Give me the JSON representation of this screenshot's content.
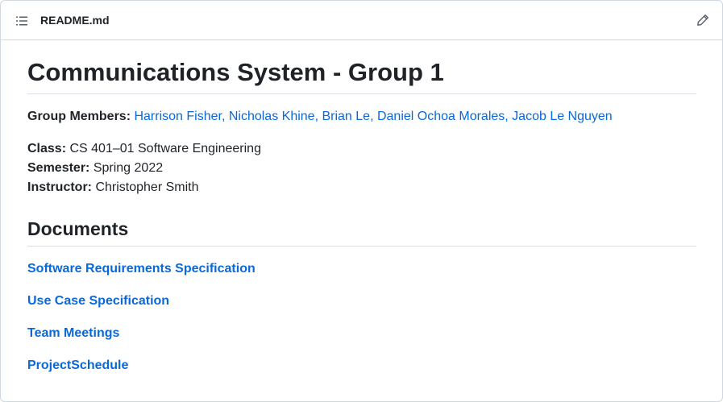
{
  "header": {
    "file_name": "README.md",
    "toc_icon": "list-unordered-icon",
    "edit_icon": "pencil-icon"
  },
  "content": {
    "title": "Communications System - Group 1",
    "members_label": "Group Members:",
    "members": [
      "Harrison Fisher,",
      "Nicholas Khine,",
      "Brian Le,",
      "Daniel Ochoa Morales,",
      "Jacob Le Nguyen"
    ],
    "class_label": "Class:",
    "class_value": "CS 401–01 Software Engineering",
    "semester_label": "Semester:",
    "semester_value": "Spring 2022",
    "instructor_label": "Instructor:",
    "instructor_value": "Christopher Smith",
    "documents_heading": "Documents",
    "documents": [
      "Software Requirements Specification",
      "Use Case Specification",
      "Team Meetings",
      "ProjectSchedule"
    ]
  },
  "colors": {
    "link": "#0969da",
    "text": "#1f2328",
    "border": "#d0d7de"
  }
}
